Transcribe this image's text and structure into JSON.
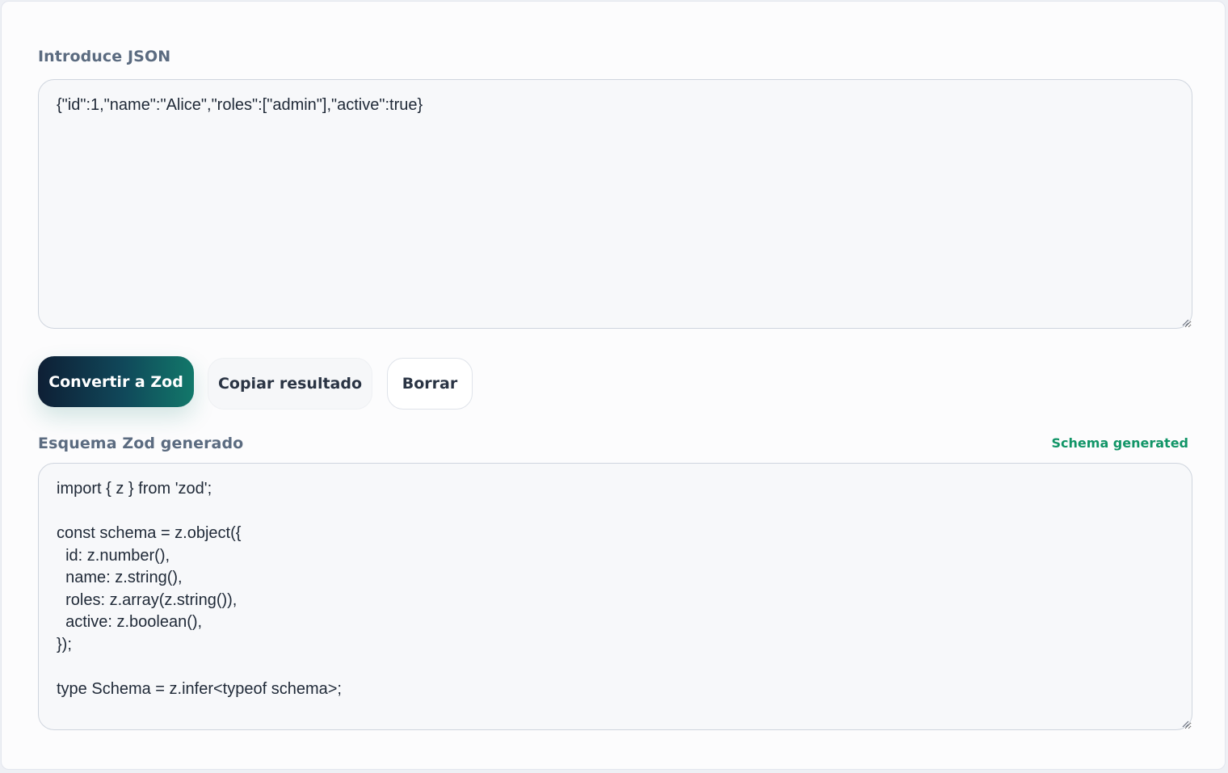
{
  "input": {
    "label": "Introduce JSON",
    "value": "{\"id\":1,\"name\":\"Alice\",\"roles\":[\"admin\"],\"active\":true}"
  },
  "actions": {
    "convert_label": "Convertir a Zod",
    "copy_label": "Copiar resultado",
    "clear_label": "Borrar"
  },
  "output": {
    "label": "Esquema Zod generado",
    "status": "Schema generated",
    "value": "import { z } from 'zod';\n\nconst schema = z.object({\n  id: z.number(),\n  name: z.string(),\n  roles: z.array(z.string()),\n  active: z.boolean(),\n});\n\ntype Schema = z.infer<typeof schema>;"
  },
  "colors": {
    "accent": "#119567",
    "primary_button_start": "#0e1f35",
    "primary_button_end": "#12786a",
    "label": "#5b6b80"
  }
}
